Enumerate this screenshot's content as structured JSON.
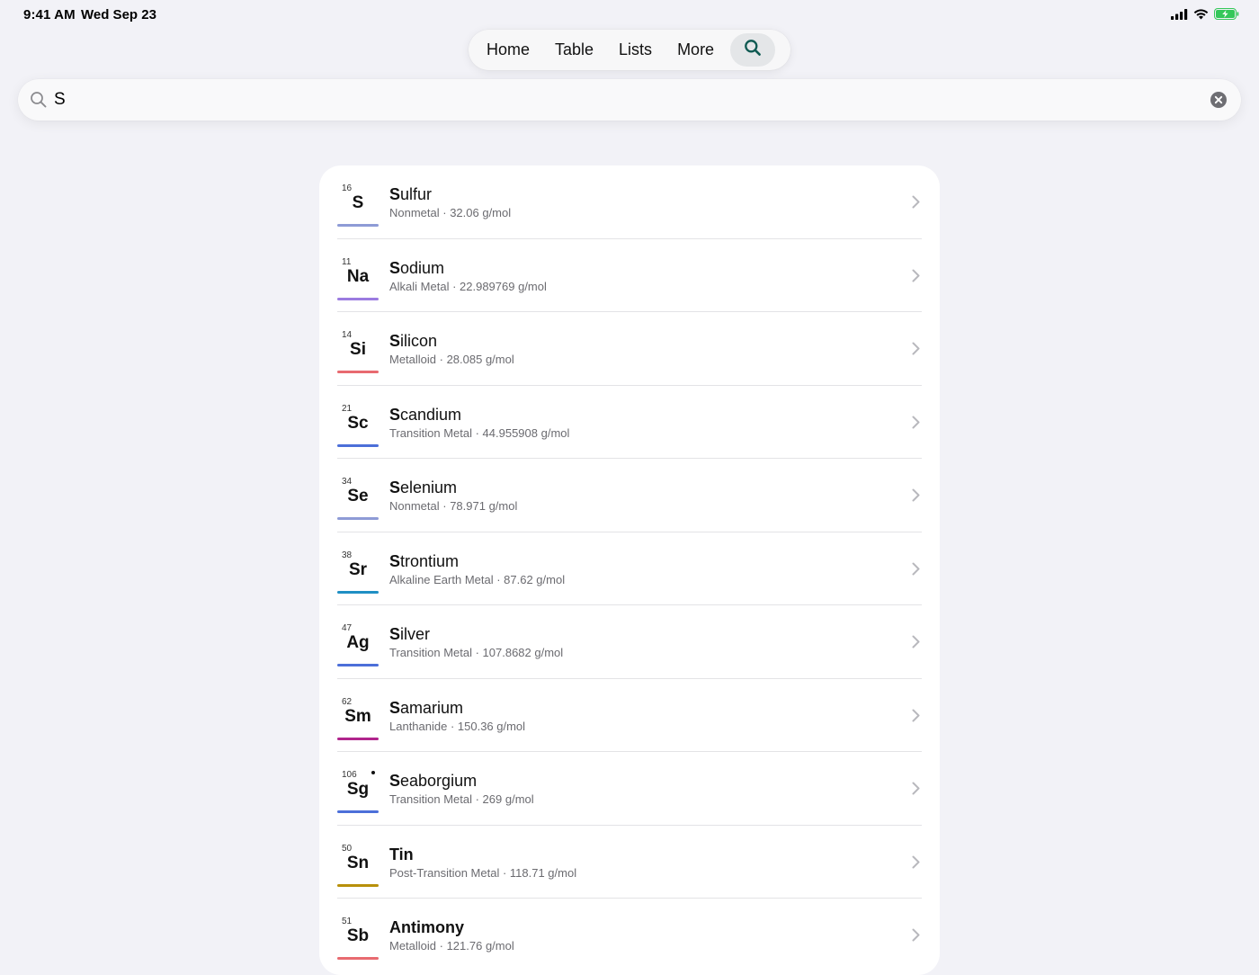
{
  "status": {
    "time": "9:41 AM",
    "date": "Wed Sep 23",
    "icons": [
      "signal-icon",
      "wifi-icon",
      "battery-charging-icon"
    ]
  },
  "tabs": [
    {
      "label": "Home"
    },
    {
      "label": "Table"
    },
    {
      "label": "Lists"
    },
    {
      "label": "More"
    }
  ],
  "search": {
    "value": "S",
    "placeholder": ""
  },
  "results": [
    {
      "num": "16",
      "sym": "S",
      "match": "S",
      "rest": "ulfur",
      "category": "Nonmetal",
      "mass": "32.06 g/mol",
      "subtitle": "Nonmetal · 32.06 g/mol",
      "color": "#8e9bd6"
    },
    {
      "num": "11",
      "sym": "Na",
      "match": "S",
      "rest": "odium",
      "category": "Alkali Metal",
      "mass": "22.989769 g/mol",
      "subtitle": "Alkali Metal · 22.989769 g/mol",
      "color": "#9b7be0"
    },
    {
      "num": "14",
      "sym": "Si",
      "match": "S",
      "rest": "ilicon",
      "category": "Metalloid",
      "mass": "28.085 g/mol",
      "subtitle": "Metalloid · 28.085 g/mol",
      "color": "#e86a70"
    },
    {
      "num": "21",
      "sym": "Sc",
      "match": "S",
      "rest": "candium",
      "category": "Transition Metal",
      "mass": "44.955908 g/mol",
      "subtitle": "Transition Metal · 44.955908 g/mol",
      "color": "#4c6fd9"
    },
    {
      "num": "34",
      "sym": "Se",
      "match": "S",
      "rest": "elenium",
      "category": "Nonmetal",
      "mass": "78.971 g/mol",
      "subtitle": "Nonmetal · 78.971 g/mol",
      "color": "#8e9bd6"
    },
    {
      "num": "38",
      "sym": "Sr",
      "match": "S",
      "rest": "trontium",
      "category": "Alkaline Earth Metal",
      "mass": "87.62 g/mol",
      "subtitle": "Alkaline Earth Metal · 87.62 g/mol",
      "color": "#1f8fc4"
    },
    {
      "num": "47",
      "sym": "Ag",
      "match": "S",
      "rest": "ilver",
      "category": "Transition Metal",
      "mass": "107.8682 g/mol",
      "subtitle": "Transition Metal · 107.8682 g/mol",
      "color": "#4c6fd9"
    },
    {
      "num": "62",
      "sym": "Sm",
      "match": "S",
      "rest": "amarium",
      "category": "Lanthanide",
      "mass": "150.36 g/mol",
      "subtitle": "Lanthanide · 150.36 g/mol",
      "color": "#b0248c"
    },
    {
      "num": "106",
      "sym": "Sg",
      "match": "S",
      "rest": "eaborgium",
      "category": "Transition Metal",
      "mass": "269 g/mol",
      "subtitle": "Transition Metal · 269 g/mol",
      "color": "#4c6fd9",
      "dot": true
    },
    {
      "num": "50",
      "sym": "Sn",
      "match": "",
      "rest": "Tin",
      "category": "Post-Transition Metal",
      "mass": "118.71 g/mol",
      "subtitle": "Post-Transition Metal · 118.71 g/mol",
      "color": "#b8900a",
      "boldAll": true
    },
    {
      "num": "51",
      "sym": "Sb",
      "match": "",
      "rest": "Antimony",
      "category": "Metalloid",
      "mass": "121.76 g/mol",
      "subtitle": "Metalloid · 121.76 g/mol",
      "color": "#e86a70",
      "boldAll": true
    }
  ]
}
